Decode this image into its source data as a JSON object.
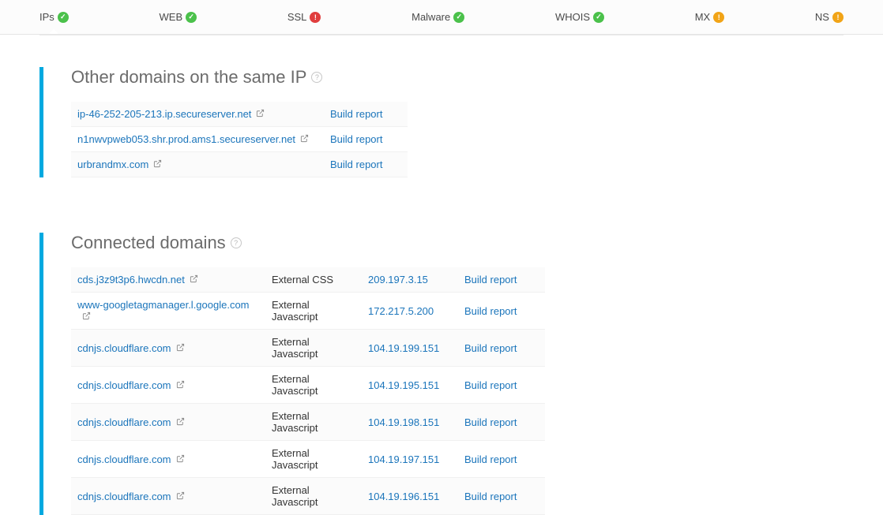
{
  "tabs": [
    {
      "label": "IPs",
      "status": "ok",
      "active": true
    },
    {
      "label": "WEB",
      "status": "ok",
      "active": false
    },
    {
      "label": "SSL",
      "status": "err",
      "active": false
    },
    {
      "label": "Malware",
      "status": "ok",
      "active": false
    },
    {
      "label": "WHOIS",
      "status": "ok",
      "active": false
    },
    {
      "label": "MX",
      "status": "warn",
      "active": false
    },
    {
      "label": "NS",
      "status": "warn",
      "active": false
    }
  ],
  "same_ip": {
    "title": "Other domains on the same IP",
    "rows": [
      {
        "domain": "ip-46-252-205-213.ip.secureserver.net",
        "action": "Build report"
      },
      {
        "domain": "n1nwvpweb053.shr.prod.ams1.secureserver.net",
        "action": "Build report"
      },
      {
        "domain": "urbrandmx.com",
        "action": "Build report"
      }
    ]
  },
  "connected": {
    "title": "Connected domains",
    "rows": [
      {
        "domain": "cds.j3z9t3p6.hwcdn.net",
        "type": "External CSS",
        "ip": "209.197.3.15",
        "action": "Build report"
      },
      {
        "domain": "www-googletagmanager.l.google.com",
        "type": "External Javascript",
        "ip": "172.217.5.200",
        "action": "Build report"
      },
      {
        "domain": "cdnjs.cloudflare.com",
        "type": "External Javascript",
        "ip": "104.19.199.151",
        "action": "Build report"
      },
      {
        "domain": "cdnjs.cloudflare.com",
        "type": "External Javascript",
        "ip": "104.19.195.151",
        "action": "Build report"
      },
      {
        "domain": "cdnjs.cloudflare.com",
        "type": "External Javascript",
        "ip": "104.19.198.151",
        "action": "Build report"
      },
      {
        "domain": "cdnjs.cloudflare.com",
        "type": "External Javascript",
        "ip": "104.19.197.151",
        "action": "Build report"
      },
      {
        "domain": "cdnjs.cloudflare.com",
        "type": "External Javascript",
        "ip": "104.19.196.151",
        "action": "Build report"
      }
    ]
  },
  "glyphs": {
    "ok": "✓",
    "err": "!",
    "warn": "!",
    "help": "?",
    "ext": "↗"
  }
}
